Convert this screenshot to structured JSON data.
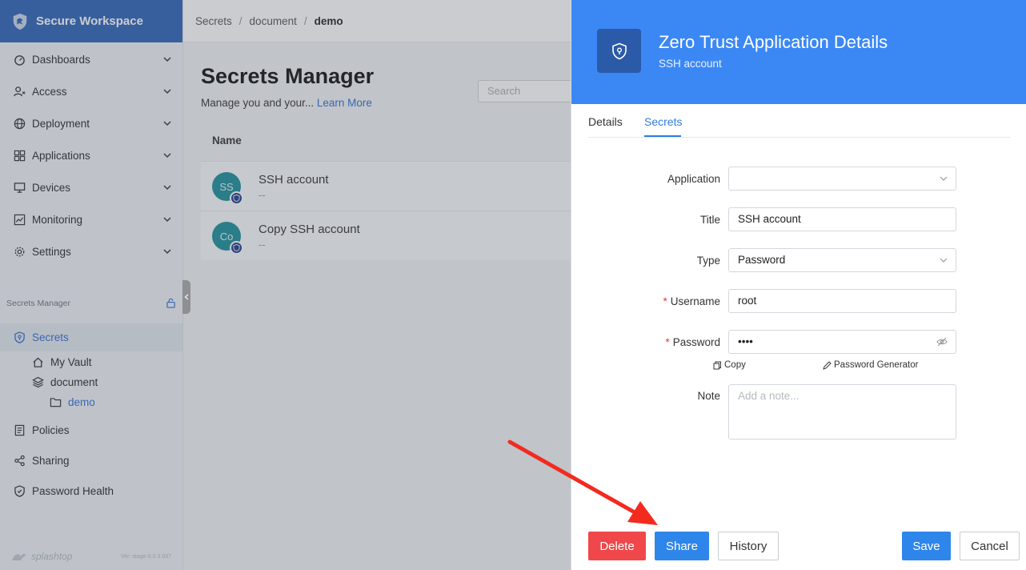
{
  "sidebar": {
    "brand": "Secure Workspace",
    "items": [
      {
        "label": "Dashboards",
        "icon": "dashboard-icon"
      },
      {
        "label": "Access",
        "icon": "access-icon"
      },
      {
        "label": "Deployment",
        "icon": "globe-icon"
      },
      {
        "label": "Applications",
        "icon": "apps-icon"
      },
      {
        "label": "Devices",
        "icon": "monitor-icon"
      },
      {
        "label": "Monitoring",
        "icon": "chart-icon"
      },
      {
        "label": "Settings",
        "icon": "gear-icon"
      }
    ],
    "section_title": "Secrets Manager",
    "secrets": "Secrets",
    "my_vault": "My Vault",
    "document": "document",
    "demo": "demo",
    "policies": "Policies",
    "sharing": "Sharing",
    "password_health": "Password Health",
    "footer_brand": "splashtop",
    "version": "Ver: stage-0.0.3.037"
  },
  "breadcrumb": {
    "a": "Secrets",
    "b": "document",
    "c": "demo",
    "sep": "/"
  },
  "main": {
    "title": "Secrets Manager",
    "desc": "Manage you and your...",
    "learn_more": "Learn More",
    "search_placeholder": "Search",
    "col_name": "Name",
    "rows": [
      {
        "initials": "SS",
        "name": "SSH account",
        "sub": "--"
      },
      {
        "initials": "Co",
        "name": "Copy SSH account",
        "sub": "--"
      }
    ]
  },
  "drawer": {
    "title": "Zero Trust Application Details",
    "subtitle": "SSH account",
    "tab_details": "Details",
    "tab_secrets": "Secrets",
    "labels": {
      "application": "Application",
      "title": "Title",
      "type": "Type",
      "username": "Username",
      "password": "Password",
      "note": "Note",
      "required_mark": "*"
    },
    "values": {
      "application": "",
      "title": "SSH account",
      "type": "Password",
      "username": "root",
      "password": "••••",
      "note_placeholder": "Add a note..."
    },
    "copy": "Copy",
    "password_generator": "Password Generator",
    "buttons": {
      "delete": "Delete",
      "share": "Share",
      "history": "History",
      "save": "Save",
      "cancel": "Cancel"
    }
  },
  "colors": {
    "brand_blue": "#2f63b8",
    "drawer_header": "#3b88f5",
    "primary": "#2e86ea",
    "danger": "#f0474a",
    "annotation_arrow": "#f22b1e"
  }
}
